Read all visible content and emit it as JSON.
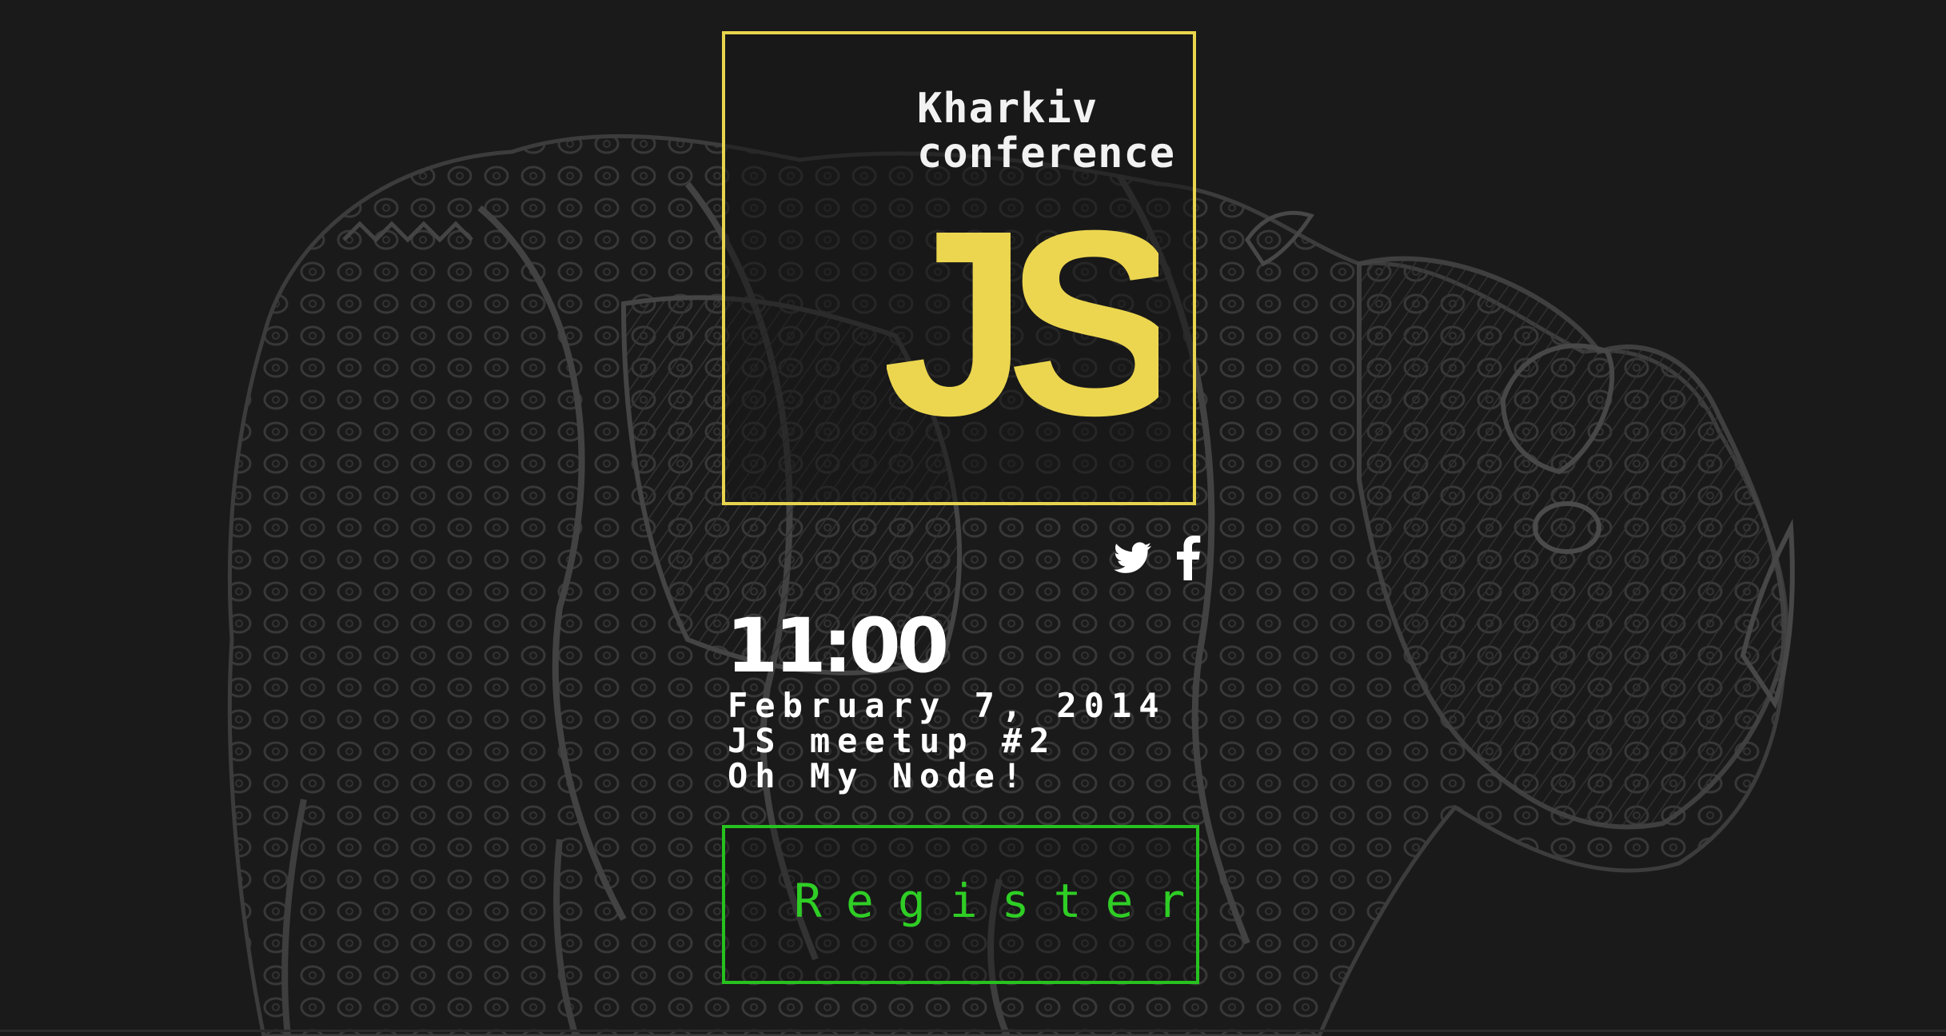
{
  "logo": {
    "line1": "Kharkiv",
    "line2": "conference",
    "mark": "JS",
    "border_color": "#e8d44d",
    "mark_color": "#ecd64f"
  },
  "social": {
    "twitter_icon": "twitter-icon",
    "facebook_icon": "facebook-icon"
  },
  "event": {
    "time": "11:00",
    "date": "February 7, 2014",
    "name": "JS meetup #2",
    "subtitle": "Oh My Node!"
  },
  "register": {
    "label": "Register",
    "color": "#2fce25"
  },
  "background": {
    "illustration": "rhinoceros-engraving",
    "color": "#1a1a1a"
  }
}
